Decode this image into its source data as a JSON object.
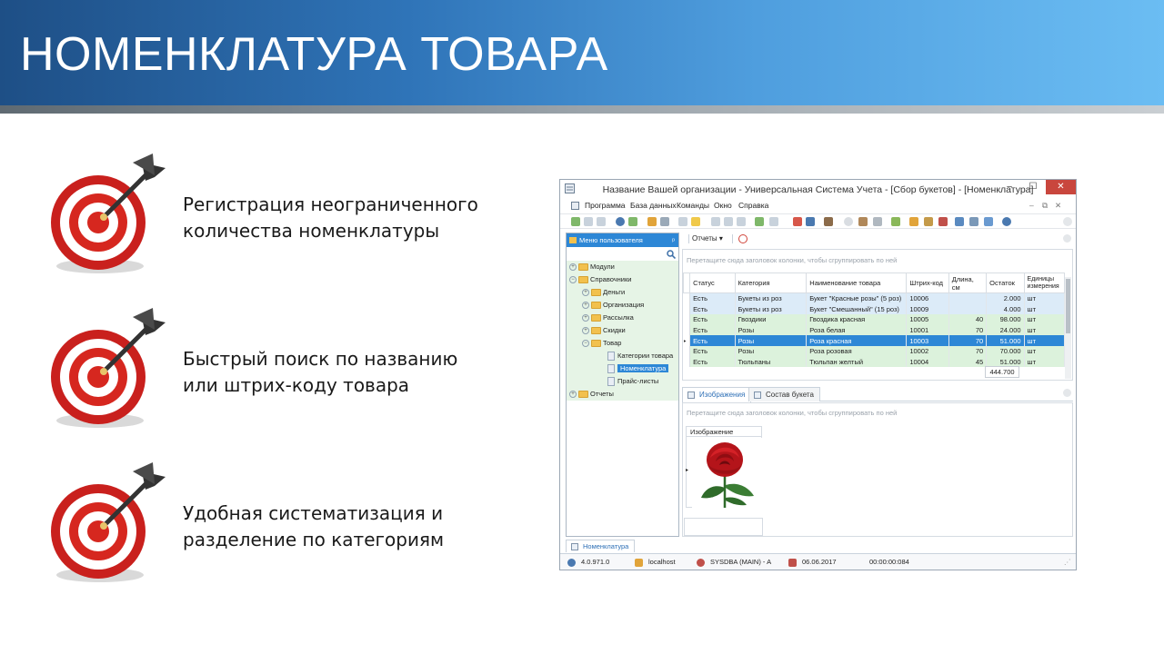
{
  "slide": {
    "title": "НОМЕНКЛАТУРА ТОВАРА",
    "features": [
      {
        "line1": "Регистрация неограниченного",
        "line2": "количества номенклатуры"
      },
      {
        "line1": "Быстрый поиск по названию",
        "line2": "или штрих-коду товара"
      },
      {
        "line1": "Удобная систематизация и",
        "line2": "разделение по категориям"
      }
    ]
  },
  "app": {
    "window_title": "Название Вашей организации - Универсальная Система Учета - [Сбор букетов] - [Номенклатура]",
    "controls": {
      "minimize": "–",
      "maximize": "☐",
      "close": "✕"
    },
    "menu": [
      "Программа",
      "База данных",
      "Команды",
      "Окно",
      "Справка"
    ],
    "mdi_controls": {
      "minimize": "–",
      "restore": "⧉",
      "close": "✕"
    },
    "sidebar": {
      "title": "Меню пользователя",
      "pin": "ᵖ",
      "items": [
        {
          "label": "Модули"
        },
        {
          "label": "Справочники"
        },
        {
          "label": "Деньги"
        },
        {
          "label": "Организация"
        },
        {
          "label": "Рассылка"
        },
        {
          "label": "Скидки"
        },
        {
          "label": "Товар"
        },
        {
          "label": "Категории товара"
        },
        {
          "label": "Номенклатура"
        },
        {
          "label": "Прайс-листы"
        },
        {
          "label": "Отчеты"
        }
      ]
    },
    "reports_button": "Отчеты ▾",
    "group_hint": "Перетащите сюда заголовок колонки, чтобы сгруппировать по ней",
    "table": {
      "columns": [
        "Статус",
        "Категория",
        "Наименование товара",
        "Штрих-код",
        "Длина, см",
        "Остаток",
        "Единицы измерения"
      ],
      "rows": [
        {
          "status": "Есть",
          "category": "Букеты из роз",
          "name": "Букет \"Красные розы\" (5 роз)",
          "code": "10006",
          "length": "",
          "stock": "2.000",
          "unit": "шт"
        },
        {
          "status": "Есть",
          "category": "Букеты из роз",
          "name": "Букет \"Смешанный\" (15 роз)",
          "code": "10009",
          "length": "",
          "stock": "4.000",
          "unit": "шт"
        },
        {
          "status": "Есть",
          "category": "Гвоздики",
          "name": "Гвоздика красная",
          "code": "10005",
          "length": "40",
          "stock": "98.000",
          "unit": "шт"
        },
        {
          "status": "Есть",
          "category": "Розы",
          "name": "Роза белая",
          "code": "10001",
          "length": "70",
          "stock": "24.000",
          "unit": "шт"
        },
        {
          "status": "Есть",
          "category": "Розы",
          "name": "Роза красная",
          "code": "10003",
          "length": "70",
          "stock": "51.000",
          "unit": "шт"
        },
        {
          "status": "Есть",
          "category": "Розы",
          "name": "Роза розовая",
          "code": "10002",
          "length": "70",
          "stock": "70.000",
          "unit": "шт"
        },
        {
          "status": "Есть",
          "category": "Тюльпаны",
          "name": "Тюльпан желтый",
          "code": "10004",
          "length": "45",
          "stock": "51.000",
          "unit": "шт"
        }
      ],
      "total": "444.700"
    },
    "detail_tabs": [
      "Изображения",
      "Состав букета"
    ],
    "detail_group_hint": "Перетащите сюда заголовок колонки, чтобы сгруппировать по ней",
    "image_column": "Изображение",
    "doc_tab": "Номенклатура",
    "status": {
      "version": "4.0.971.0",
      "server": "localhost",
      "user": "SYSDBA (MAIN) - A",
      "date": "06.06.2017",
      "timer": "00:00:00:084"
    }
  }
}
